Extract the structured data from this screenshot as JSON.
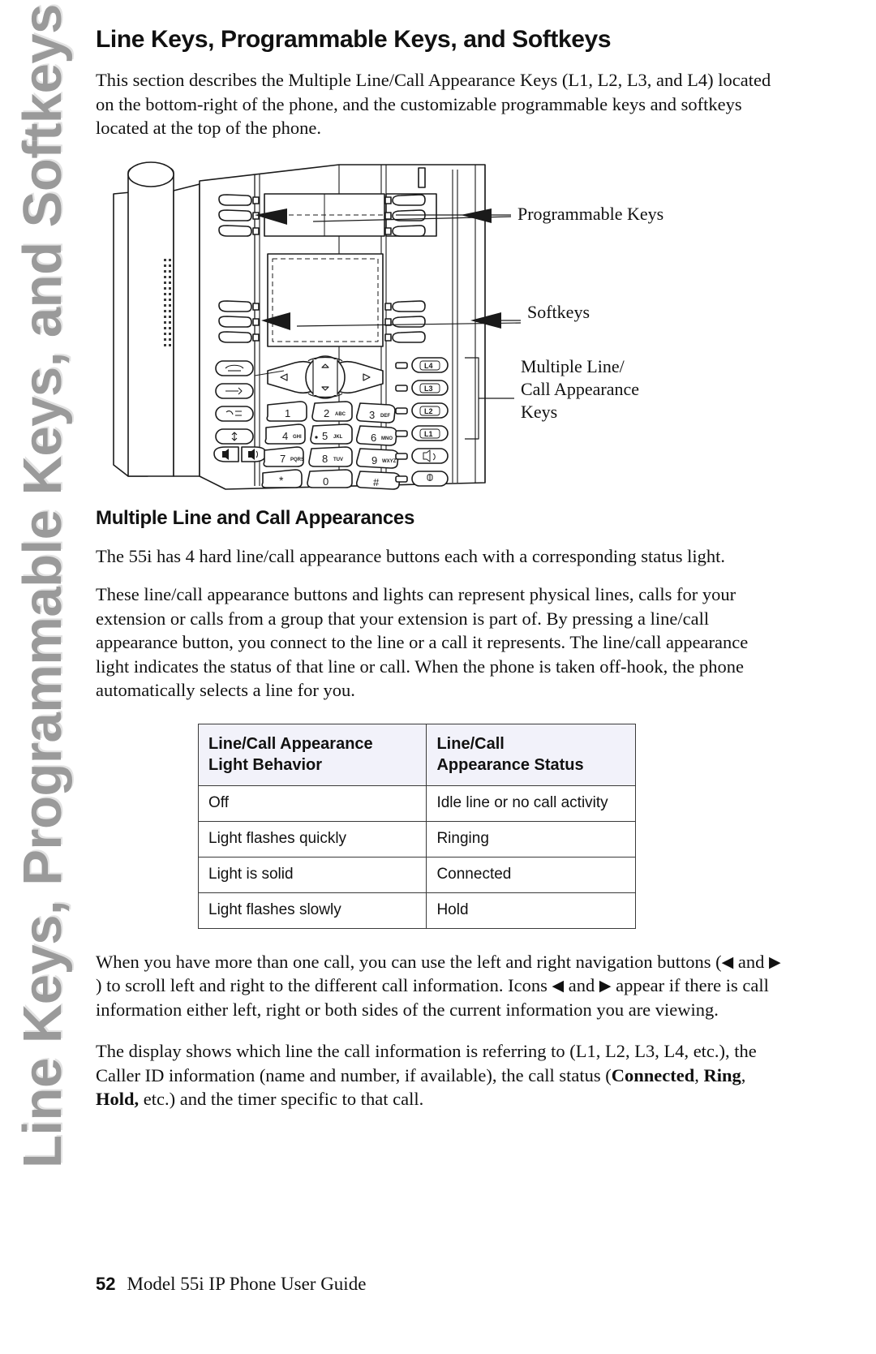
{
  "side_tab": {
    "label": "Line Keys, Programmable Keys, and Softkeys"
  },
  "page": {
    "title": "Line Keys, Programmable Keys, and Softkeys",
    "intro": "This section describes the Multiple Line/Call Appearance Keys (L1, L2, L3, and L4) located on the bottom-right of the phone, and the customizable programmable keys and softkeys located at the top of the phone."
  },
  "figure": {
    "callouts": {
      "programmable_keys": "Programmable Keys",
      "softkeys": "Softkeys",
      "multiple_line": "Multiple Line/\nCall Appearance\nKeys"
    },
    "line_keys": [
      "L4",
      "L3",
      "L2",
      "L1"
    ],
    "keypad": [
      {
        "digit": "1",
        "letters": ""
      },
      {
        "digit": "2",
        "letters": "ABC"
      },
      {
        "digit": "3",
        "letters": "DEF"
      },
      {
        "digit": "4",
        "letters": "GHI"
      },
      {
        "digit": "5",
        "letters": "JKL"
      },
      {
        "digit": "6",
        "letters": "MNO"
      },
      {
        "digit": "7",
        "letters": "PQRS"
      },
      {
        "digit": "8",
        "letters": "TUV"
      },
      {
        "digit": "9",
        "letters": "WXYZ"
      },
      {
        "digit": "*",
        "letters": ""
      },
      {
        "digit": "0",
        "letters": ""
      },
      {
        "digit": "#",
        "letters": ""
      }
    ]
  },
  "section": {
    "title": "Multiple Line and Call Appearances",
    "p1": "The 55i has 4 hard line/call appearance buttons each with a corresponding status light.",
    "p2": "These line/call appearance buttons and lights can represent physical lines, calls for your extension or calls from a group that your extension is part of. By pressing a line/call appearance button, you connect to the line or a call it represents. The line/call appearance light indicates the status of that line or call. When the phone is taken off-hook, the phone automatically selects a line for you.",
    "p3_a": "When you have more than one call, you can use the left and right navigation buttons (",
    "p3_b": " and ",
    "p3_c": " ) to scroll left and right to the different call information. Icons ",
    "p3_d": " and ",
    "p3_e": " appear if there is call information either left, right or both sides of the current information you are viewing.",
    "p4_a": "The display shows which line the call information is referring to (L1, L2, L3, L4, etc.), the Caller ID information (name and number, if available), the call status (",
    "p4_bold1": "Connected",
    "p4_sep1": ", ",
    "p4_bold2": "Ring",
    "p4_sep2": ", ",
    "p4_bold3": "Hold,",
    "p4_end": " etc.) and the timer specific to that call."
  },
  "table": {
    "headers": [
      "Line/Call Appearance\nLight Behavior",
      "Line/Call\nAppearance Status"
    ],
    "rows": [
      [
        "Off",
        "Idle line or no call activity"
      ],
      [
        "Light flashes quickly",
        "Ringing"
      ],
      [
        "Light is solid",
        "Connected"
      ],
      [
        "Light flashes slowly",
        "Hold"
      ]
    ],
    "header_bg": "#f2f2fa"
  },
  "footer": {
    "page_number": "52",
    "guide_title": "Model 55i IP Phone User Guide"
  }
}
